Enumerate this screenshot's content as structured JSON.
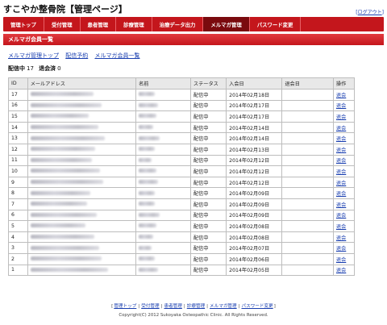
{
  "header": {
    "title": "すこやか整骨院【管理ページ】",
    "logout_label": "ログアウト",
    "logout_prefix": "[",
    "logout_suffix": "]"
  },
  "nav": {
    "items": [
      {
        "label": "管理トップ",
        "active": false
      },
      {
        "label": "受付管理",
        "active": false
      },
      {
        "label": "患者管理",
        "active": false
      },
      {
        "label": "診療管理",
        "active": false
      },
      {
        "label": "治療データ出力",
        "active": false
      },
      {
        "label": "メルマガ管理",
        "active": true
      },
      {
        "label": "パスワード変更",
        "active": false
      }
    ]
  },
  "section": {
    "title": "メルマガ会員一覧"
  },
  "subnav": {
    "items": [
      "メルマガ管理トップ",
      "配信予約",
      "メルマガ会員一覧"
    ]
  },
  "counts": {
    "active_label": "配信中",
    "active_count": "17",
    "cancel_label": "退会済",
    "cancel_count": "0"
  },
  "table": {
    "headers": [
      "ID",
      "メールアドレス",
      "名前",
      "ステータス",
      "入会日",
      "退会日",
      "操作"
    ],
    "rows": [
      {
        "id": "17",
        "status": "配信中",
        "joined": "2014年02月18日",
        "left": "",
        "action": "退会"
      },
      {
        "id": "16",
        "status": "配信中",
        "joined": "2014年02月17日",
        "left": "",
        "action": "退会"
      },
      {
        "id": "15",
        "status": "配信中",
        "joined": "2014年02月17日",
        "left": "",
        "action": "退会"
      },
      {
        "id": "14",
        "status": "配信中",
        "joined": "2014年02月14日",
        "left": "",
        "action": "退会"
      },
      {
        "id": "13",
        "status": "配信中",
        "joined": "2014年02月14日",
        "left": "",
        "action": "退会"
      },
      {
        "id": "12",
        "status": "配信中",
        "joined": "2014年02月13日",
        "left": "",
        "action": "退会"
      },
      {
        "id": "11",
        "status": "配信中",
        "joined": "2014年02月12日",
        "left": "",
        "action": "退会"
      },
      {
        "id": "10",
        "status": "配信中",
        "joined": "2014年02月12日",
        "left": "",
        "action": "退会"
      },
      {
        "id": "9",
        "status": "配信中",
        "joined": "2014年02月12日",
        "left": "",
        "action": "退会"
      },
      {
        "id": "8",
        "status": "配信中",
        "joined": "2014年02月09日",
        "left": "",
        "action": "退会"
      },
      {
        "id": "7",
        "status": "配信中",
        "joined": "2014年02月09日",
        "left": "",
        "action": "退会"
      },
      {
        "id": "6",
        "status": "配信中",
        "joined": "2014年02月09日",
        "left": "",
        "action": "退会"
      },
      {
        "id": "5",
        "status": "配信中",
        "joined": "2014年02月08日",
        "left": "",
        "action": "退会"
      },
      {
        "id": "4",
        "status": "配信中",
        "joined": "2014年02月08日",
        "left": "",
        "action": "退会"
      },
      {
        "id": "3",
        "status": "配信中",
        "joined": "2014年02月07日",
        "left": "",
        "action": "退会"
      },
      {
        "id": "2",
        "status": "配信中",
        "joined": "2014年02月06日",
        "left": "",
        "action": "退会"
      },
      {
        "id": "1",
        "status": "配信中",
        "joined": "2014年02月05日",
        "left": "",
        "action": "退会"
      }
    ]
  },
  "footer": {
    "links": [
      "管理トップ",
      "受付管理",
      "患者管理",
      "診療管理",
      "メルマガ管理",
      "パスワード変更"
    ],
    "open_bracket": "[",
    "close_bracket": "]",
    "separator": "|",
    "copyright": "Copyright(C) 2012 Sukoyaka Osteopathic Clinic. All Rights Reserved."
  }
}
